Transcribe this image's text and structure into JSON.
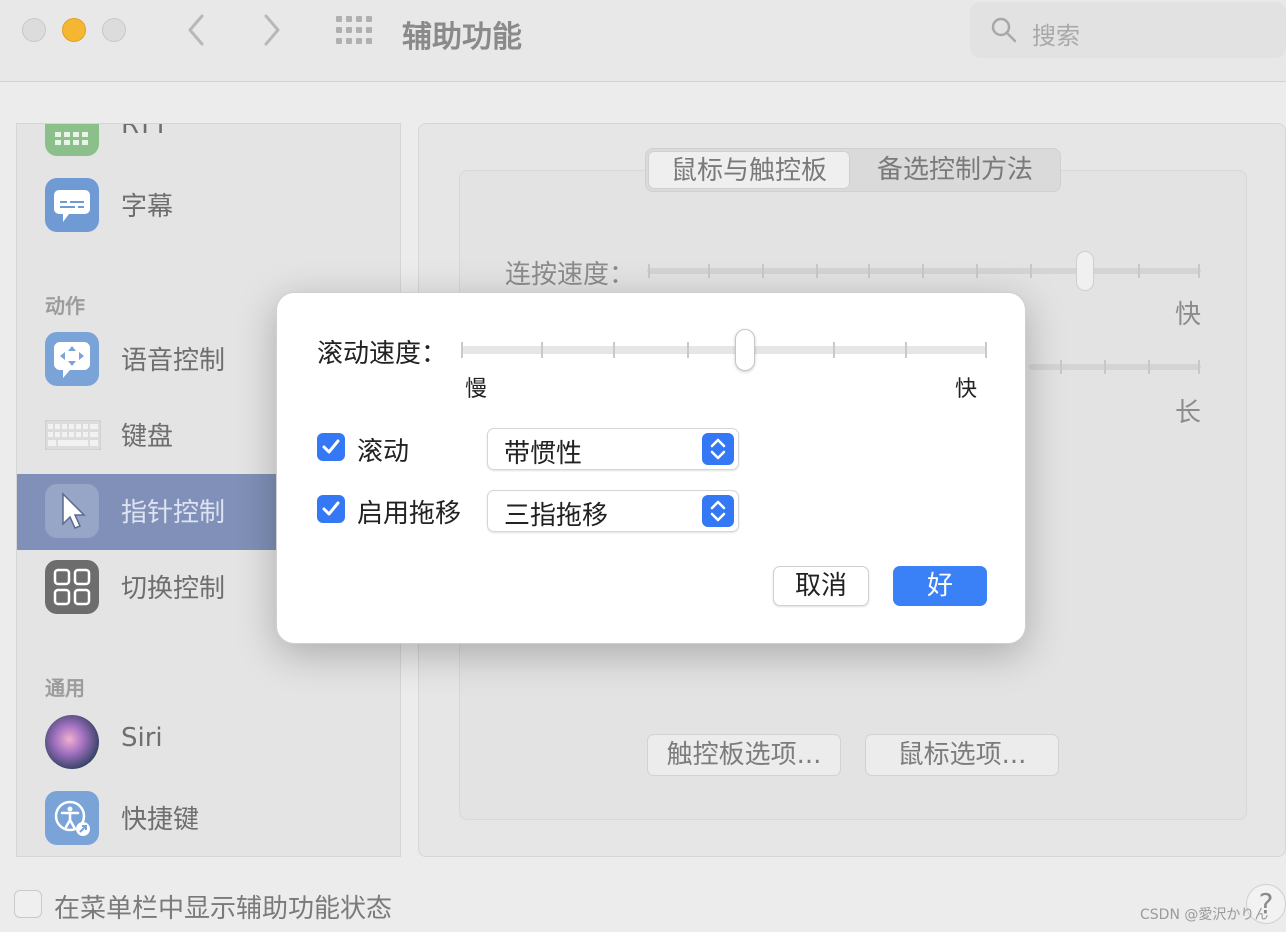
{
  "window": {
    "title": "辅助功能",
    "search_placeholder": "搜索"
  },
  "sidebar": {
    "items_top": [
      {
        "label": "RTT",
        "icon": "keyboard-grid-icon"
      },
      {
        "label": "字幕",
        "icon": "caption-bubble-icon"
      }
    ],
    "section_action": "动作",
    "items_action": [
      {
        "label": "语音控制",
        "icon": "voice-control-icon"
      },
      {
        "label": "键盘",
        "icon": "keyboard-icon"
      },
      {
        "label": "指针控制",
        "icon": "pointer-icon",
        "selected": true
      },
      {
        "label": "切换控制",
        "icon": "switch-grid-icon"
      }
    ],
    "section_general": "通用",
    "items_general": [
      {
        "label": "Siri",
        "icon": "siri-icon"
      },
      {
        "label": "快捷键",
        "icon": "accessibility-shortcut-icon"
      }
    ]
  },
  "main": {
    "tabs": [
      {
        "label": "鼠标与触控板",
        "selected": true
      },
      {
        "label": "备选控制方法",
        "selected": false
      }
    ],
    "double_click_speed_label": "连按速度：",
    "double_click_fast": "快",
    "spring_loading_long": "长",
    "trackpad_options_button": "触控板选项...",
    "mouse_options_button": "鼠标选项..."
  },
  "bottom": {
    "show_status_label": "在菜单栏中显示辅助功能状态",
    "help": "?"
  },
  "watermark": "CSDN @愛沢かりん",
  "dialog": {
    "scroll_speed_label": "滚动速度：",
    "scroll_speed_value": 0.54,
    "slow_label": "慢",
    "fast_label": "快",
    "scroll_checkbox_label": "滚动",
    "scroll_checked": true,
    "scroll_option": "带惯性",
    "drag_checkbox_label": "启用拖移",
    "drag_checked": true,
    "drag_option": "三指拖移",
    "cancel_button": "取消",
    "ok_button": "好"
  },
  "colors": {
    "accent": "#3478f6",
    "selected_sidebar": "#8090b8"
  }
}
